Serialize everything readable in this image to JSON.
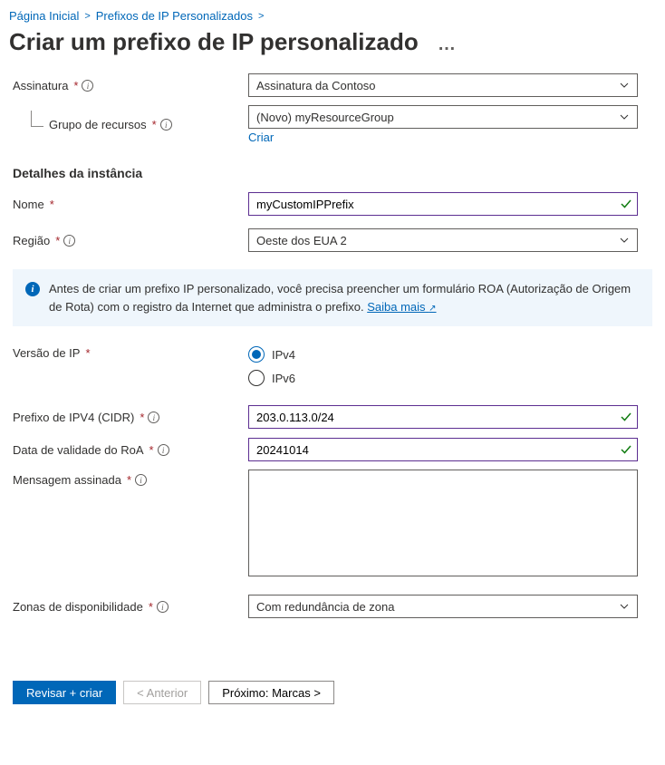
{
  "breadcrumb": {
    "home": "Página Inicial",
    "prefixes": "Prefixos de IP Personalizados"
  },
  "title": "Criar um prefixo de IP personalizado",
  "labels": {
    "subscription": "Assinatura",
    "resourceGroup": "Grupo de recursos",
    "createNewLink": "Criar",
    "instanceDetailsHeader": "Detalhes da instância",
    "name": "Nome",
    "region": "Região",
    "ipVersion": "Versão de IP",
    "cidr": "Prefixo de IPV4 (CIDR)",
    "roaExpiry": "Data de validade do RoA",
    "signedMessage": "Mensagem assinada",
    "availabilityZones": "Zonas de disponibilidade"
  },
  "values": {
    "subscription": "Assinatura da Contoso",
    "resourceGroup": "(Novo) myResourceGroup",
    "name": "myCustomIPPrefix",
    "region": "Oeste dos EUA 2",
    "cidr": "203.0.113.0/24",
    "roaExpiry": "20241014",
    "signedMessage": "",
    "availabilityZones": "Com redundância de zona"
  },
  "ipOptions": {
    "ipv4": "IPv4",
    "ipv6": "IPv6",
    "selected": "ipv4"
  },
  "infoBanner": {
    "text": "Antes de criar um prefixo IP personalizado, você precisa preencher um formulário ROA (Autorização de Origem de Rota) com o registro da Internet que administra o prefixo.",
    "learnMore": "Saiba mais"
  },
  "footer": {
    "reviewCreate": "Revisar + criar",
    "previous": "< Anterior",
    "next": "Próximo: Marcas >"
  }
}
